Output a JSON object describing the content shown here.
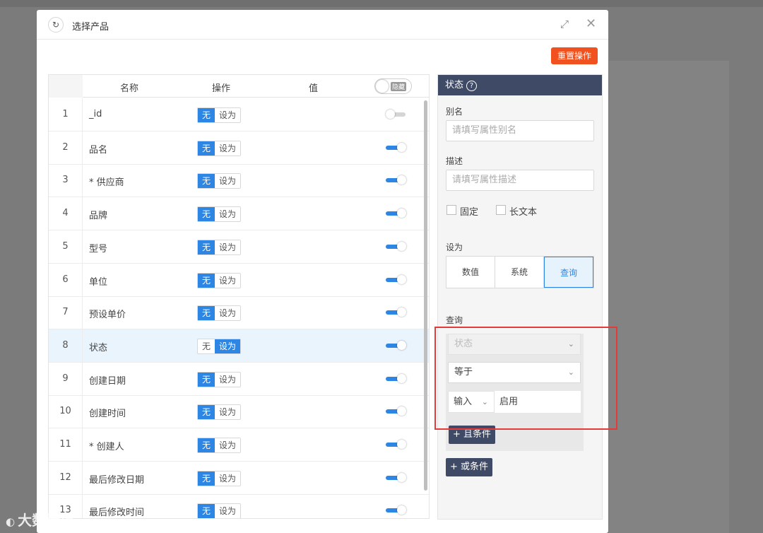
{
  "dialog": {
    "title": "选择产品",
    "reset_label": "重置操作"
  },
  "table": {
    "headers": {
      "name": "名称",
      "op": "操作",
      "value": "值",
      "toggle_text": "隐藏"
    },
    "op_none": "无",
    "op_set": "设为",
    "rows": [
      {
        "num": "1",
        "name": "_id",
        "op": "无",
        "enabled": false
      },
      {
        "num": "2",
        "name": "品名",
        "op": "无",
        "enabled": true
      },
      {
        "num": "3",
        "name": "* 供应商",
        "op": "无",
        "enabled": true
      },
      {
        "num": "4",
        "name": "品牌",
        "op": "无",
        "enabled": true
      },
      {
        "num": "5",
        "name": "型号",
        "op": "无",
        "enabled": true
      },
      {
        "num": "6",
        "name": "单位",
        "op": "无",
        "enabled": true
      },
      {
        "num": "7",
        "name": "预设单价",
        "op": "无",
        "enabled": true
      },
      {
        "num": "8",
        "name": "状态",
        "op": "设为",
        "enabled": true
      },
      {
        "num": "9",
        "name": "创建日期",
        "op": "无",
        "enabled": true
      },
      {
        "num": "10",
        "name": "创建时间",
        "op": "无",
        "enabled": true
      },
      {
        "num": "11",
        "name": "* 创建人",
        "op": "无",
        "enabled": true
      },
      {
        "num": "12",
        "name": "最后修改日期",
        "op": "无",
        "enabled": true
      },
      {
        "num": "13",
        "name": "最后修改时间",
        "op": "无",
        "enabled": true
      }
    ]
  },
  "side": {
    "title": "状态",
    "alias_label": "别名",
    "alias_placeholder": "请填写属性别名",
    "desc_label": "描述",
    "desc_placeholder": "请填写属性描述",
    "fixed_label": "固定",
    "longtext_label": "长文本",
    "setas_label": "设为",
    "setas_tabs": [
      "数值",
      "系统",
      "查询"
    ],
    "setas_active": "查询",
    "query_label": "查询",
    "query_field": "状态",
    "query_operator": "等于",
    "query_input_type": "输入",
    "query_value": "启用",
    "and_button": "+ 且条件",
    "or_button": "+ 或条件"
  },
  "watermark": "大数跨境",
  "colors": {
    "primary": "#2d86e4",
    "danger": "#f0511f",
    "header": "#3f4a66",
    "highlight": "#e43a3a"
  }
}
